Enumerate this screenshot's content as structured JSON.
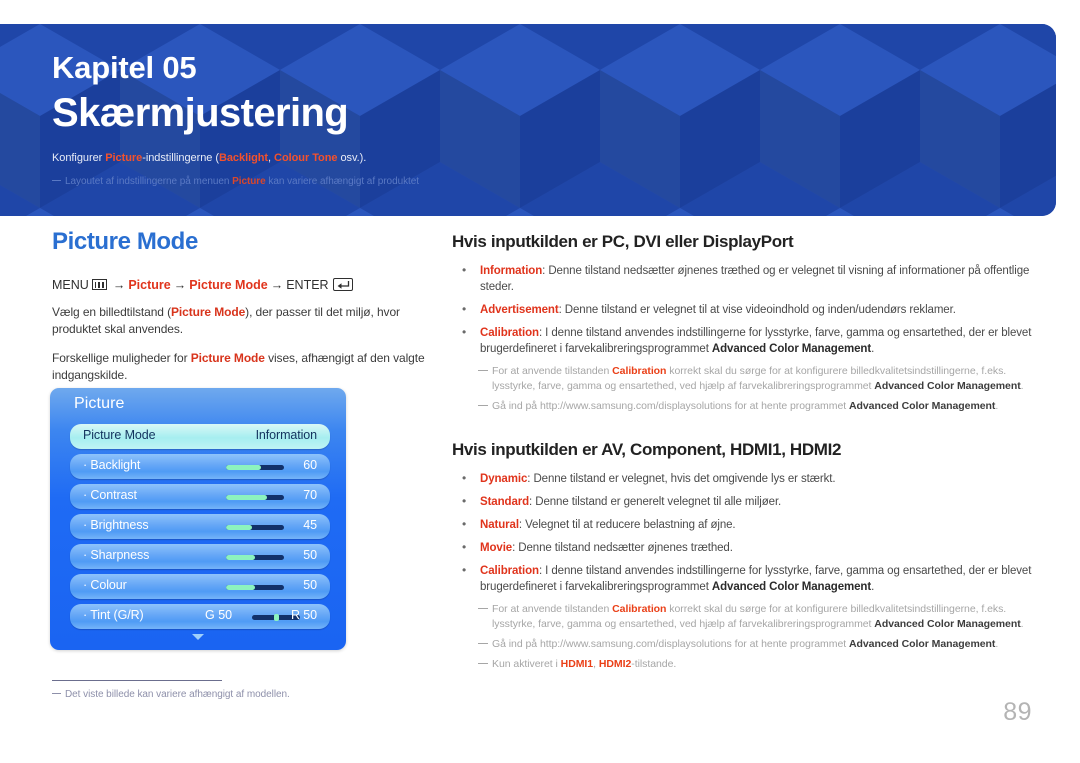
{
  "banner": {
    "chapter_label": "Kapitel 05",
    "chapter_title": "Skærmjustering",
    "description_prefix": "Konfigurer ",
    "description_hl1": "Picture",
    "description_mid": "-indstillingerne (",
    "description_hl2": "Backlight",
    "description_comma": ", ",
    "description_hl3": "Colour Tone",
    "description_suffix": " osv.).",
    "note_prefix": "Layoutet af indstillingerne på menuen ",
    "note_hl": "Picture",
    "note_suffix": " kan variere afhængigt af produktet",
    "bg_color": "#1f46a8",
    "accent_color": "#f4512c"
  },
  "left": {
    "section_title": "Picture Mode",
    "menu_path": {
      "menu_label": "MENU",
      "arrow": "→",
      "step1": "Picture",
      "step2": "Picture Mode",
      "enter_label": "ENTER"
    },
    "para1_a": "Vælg en billedtilstand (",
    "para1_b": "Picture Mode",
    "para1_c": "), der passer til det miljø, hvor produktet skal anvendes.",
    "para2_a": "Forskellige muligheder for ",
    "para2_b": "Picture Mode",
    "para2_c": " vises, afhængigt af den valgte indgangskilde.",
    "footnote": "Det viste billede kan variere afhængigt af modellen."
  },
  "osd": {
    "title": "Picture",
    "rows": [
      {
        "label": "Picture Mode",
        "value": "Information",
        "selected": true,
        "type": "option"
      },
      {
        "label": "· Backlight",
        "value": "60",
        "selected": false,
        "type": "slider",
        "fill_pct": 60
      },
      {
        "label": "· Contrast",
        "value": "70",
        "selected": false,
        "type": "slider",
        "fill_pct": 70
      },
      {
        "label": "· Brightness",
        "value": "45",
        "selected": false,
        "type": "slider",
        "fill_pct": 45
      },
      {
        "label": "· Sharpness",
        "value": "50",
        "selected": false,
        "type": "slider",
        "fill_pct": 50
      },
      {
        "label": "· Colour",
        "value": "50",
        "selected": false,
        "type": "slider",
        "fill_pct": 50
      },
      {
        "label": "· Tint (G/R)",
        "value": "R 50",
        "tint_left": "G 50",
        "selected": false,
        "type": "tint"
      }
    ],
    "scroll_icon": "chevron-down-icon",
    "slider_fill_color": "#8cf3bf",
    "slider_track_color": "#12316b"
  },
  "right": {
    "section1": {
      "title": "Hvis inputkilden er PC, DVI eller DisplayPort",
      "bullets": [
        {
          "term": "Information",
          "text": ": Denne tilstand nedsætter øjnenes træthed og er velegnet til visning af informationer på offentlige steder."
        },
        {
          "term": "Advertisement",
          "text": ": Denne tilstand er velegnet til at vise videoindhold og inden/udendørs reklamer."
        },
        {
          "term": "Calibration",
          "text": ": I denne tilstand anvendes indstillingerne for lysstyrke, farve, gamma og ensartethed, der er blevet brugerdefineret i farvekalibreringsprogrammet ",
          "bold_tail": "Advanced Color Management",
          "tail": "."
        }
      ],
      "notes": [
        {
          "pre": "For at anvende tilstanden ",
          "term": "Calibration",
          "mid": " korrekt skal du sørge for at konfigurere billedkvalitetsindstillingerne, f.eks. lysstyrke, farve, gamma og ensartethed, ved hjælp af farvekalibreringsprogrammet ",
          "bold": "Advanced Color Management",
          "post": "."
        },
        {
          "pre": "Gå ind på http://www.samsung.com/displaysolutions for at hente programmet ",
          "bold": "Advanced Color Management",
          "post": "."
        }
      ]
    },
    "section2": {
      "title": "Hvis inputkilden er AV, Component, HDMI1, HDMI2",
      "bullets": [
        {
          "term": "Dynamic",
          "text": ": Denne tilstand er velegnet, hvis det omgivende lys er stærkt."
        },
        {
          "term": "Standard",
          "text": ": Denne tilstand er generelt velegnet til alle miljøer."
        },
        {
          "term": "Natural",
          "text": ": Velegnet til at reducere belastning af øjne."
        },
        {
          "term": "Movie",
          "text": ": Denne tilstand nedsætter øjnenes træthed."
        },
        {
          "term": "Calibration",
          "text": ": I denne tilstand anvendes indstillingerne for lysstyrke, farve, gamma og ensartethed, der er blevet brugerdefineret i farvekalibreringsprogrammet ",
          "bold_tail": "Advanced Color Management",
          "tail": "."
        }
      ],
      "notes": [
        {
          "pre": "For at anvende tilstanden ",
          "term": "Calibration",
          "mid": " korrekt skal du sørge for at konfigurere billedkvalitetsindstillingerne, f.eks. lysstyrke, farve, gamma og ensartethed, ved hjælp af farvekalibreringsprogrammet ",
          "bold": "Advanced Color Management",
          "post": "."
        },
        {
          "pre": "Gå ind på http://www.samsung.com/displaysolutions for at hente programmet ",
          "bold": "Advanced Color Management",
          "post": "."
        },
        {
          "pre": "Kun aktiveret i ",
          "term": "HDMI1",
          "mid": ", ",
          "term2": "HDMI2",
          "post": "-tilstande."
        }
      ]
    }
  },
  "page_number": "89"
}
